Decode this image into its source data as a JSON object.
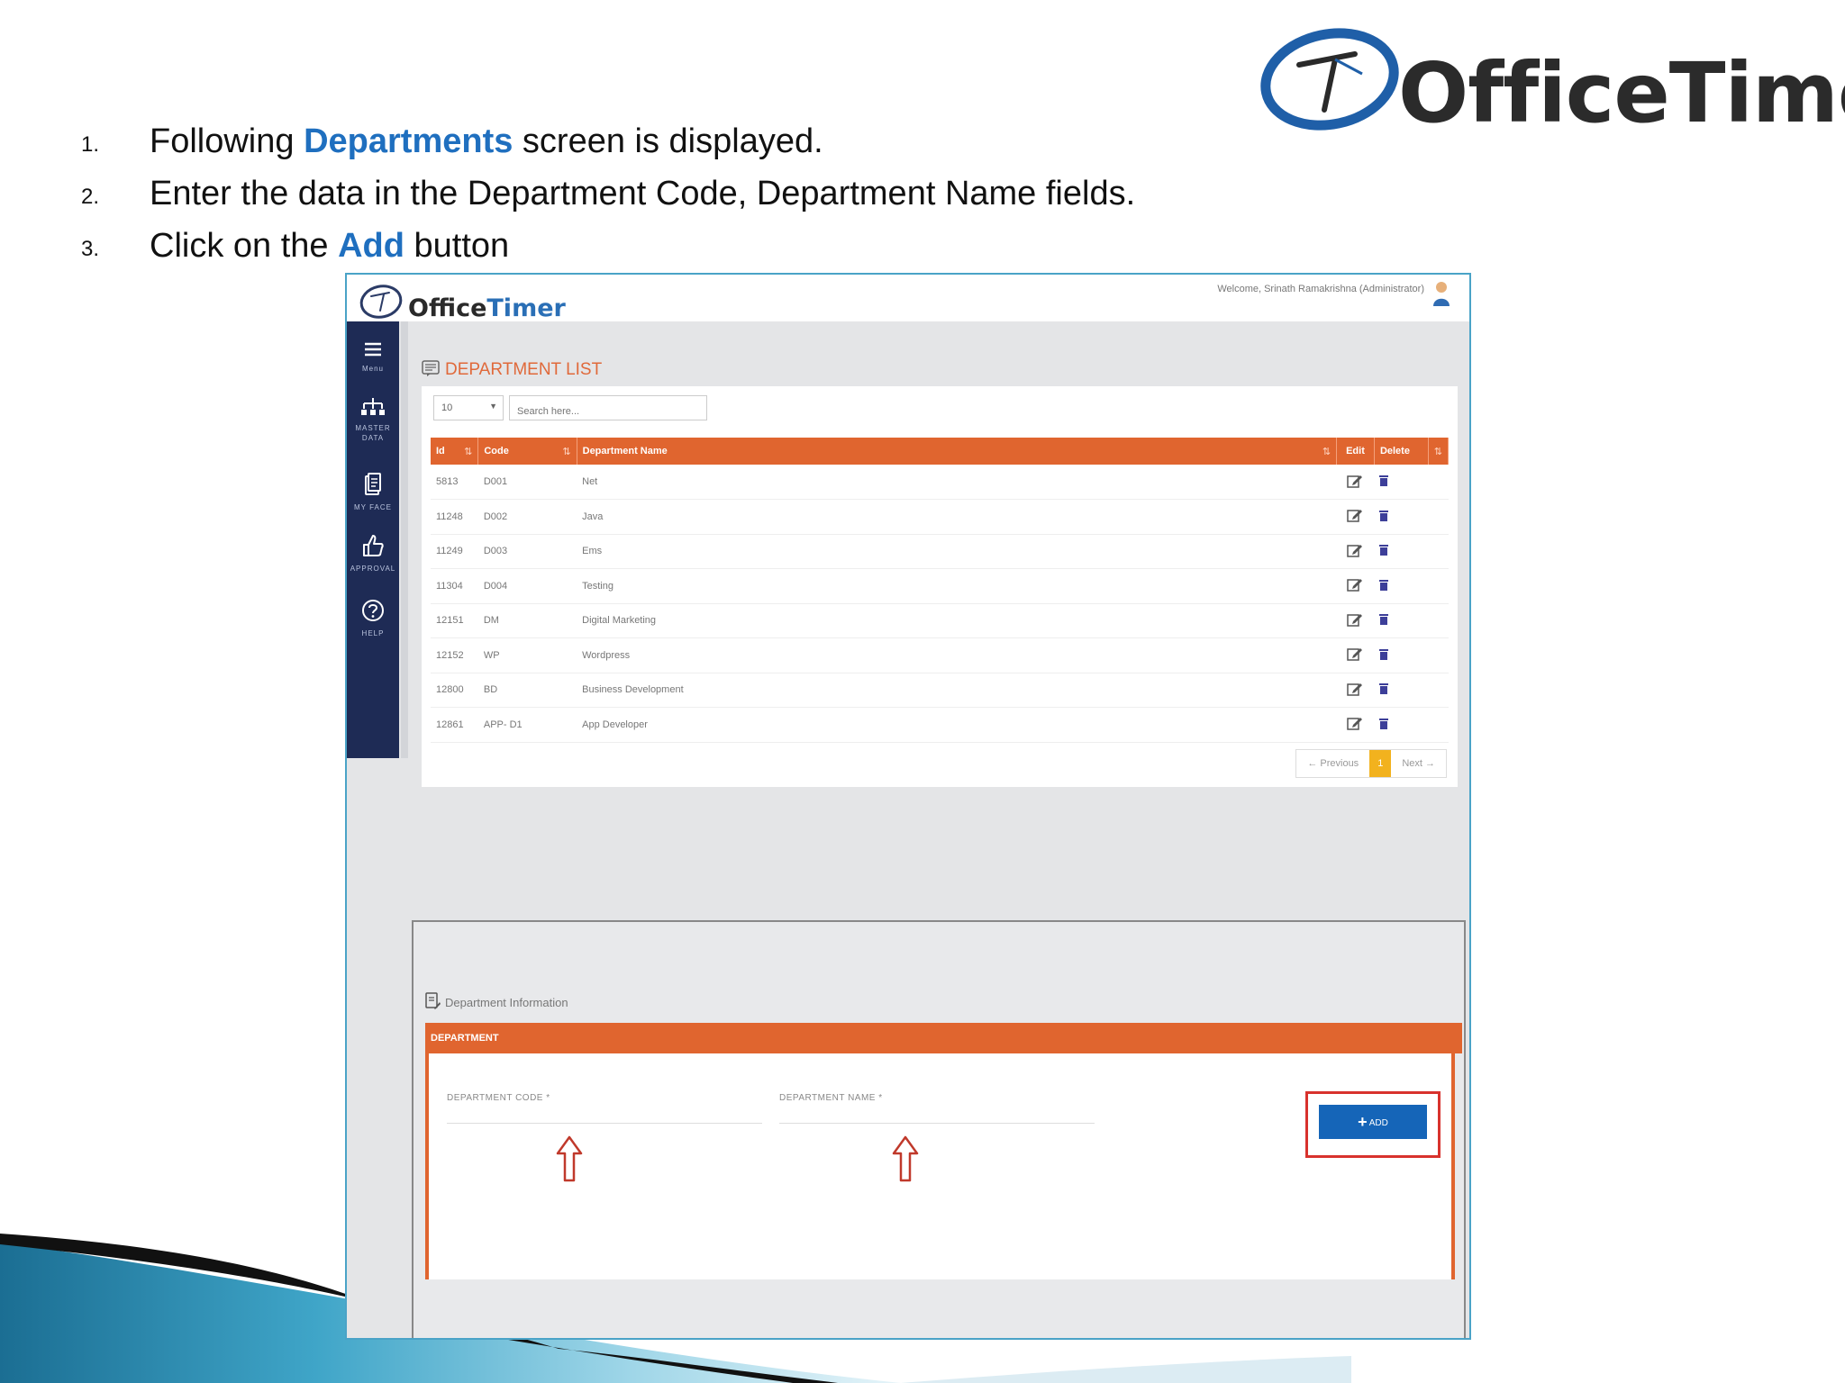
{
  "brand": {
    "name_part1": "Office",
    "name_part2": "Timer",
    "name_full": "OfficeTimer",
    "accent": "#1f6fbf",
    "orange": "#e0652f",
    "navy": "#1e2b55"
  },
  "steps": [
    {
      "num": "1.",
      "before": "Following ",
      "highlight": "Departments",
      "after": " screen is displayed."
    },
    {
      "num": "2.",
      "text": "Enter the data in the Department Code, Department Name fields."
    },
    {
      "num": "3.",
      "before": "Click on the ",
      "highlight": "Add",
      "after": " button"
    }
  ],
  "app": {
    "welcome": "Welcome, Srinath Ramakrishna (Administrator)",
    "nav": [
      {
        "icon": "menu-icon",
        "label": "Menu"
      },
      {
        "icon": "hierarchy-icon",
        "label": "MASTER DATA"
      },
      {
        "icon": "document-icon",
        "label": "MY FACE"
      },
      {
        "icon": "thumbs-up-icon",
        "label": "APPROVAL"
      },
      {
        "icon": "help-icon",
        "label": "HELP"
      }
    ],
    "list_title": "DEPARTMENT LIST",
    "page_length": "10",
    "search_placeholder": "Search here...",
    "columns": {
      "id": "Id",
      "code": "Code",
      "name": "Department Name",
      "edit": "Edit",
      "delete": "Delete"
    },
    "rows": [
      {
        "id": "5813",
        "code": "D001",
        "name": "Net"
      },
      {
        "id": "11248",
        "code": "D002",
        "name": "Java"
      },
      {
        "id": "11249",
        "code": "D003",
        "name": "Ems"
      },
      {
        "id": "11304",
        "code": "D004",
        "name": "Testing"
      },
      {
        "id": "12151",
        "code": "DM",
        "name": "Digital Marketing"
      },
      {
        "id": "12152",
        "code": "WP",
        "name": "Wordpress"
      },
      {
        "id": "12800",
        "code": "BD",
        "name": "Business Development"
      },
      {
        "id": "12861",
        "code": "APP- D1",
        "name": "App Developer"
      }
    ],
    "pager": {
      "prev": "← Previous",
      "current": "1",
      "next": "Next →"
    },
    "info_title": "Department Information",
    "form_header": "DEPARTMENT",
    "code_label": "DEPARTMENT CODE *",
    "name_label": "DEPARTMENT NAME *",
    "add_label": "ADD",
    "highlight_color": "#d8322d"
  }
}
